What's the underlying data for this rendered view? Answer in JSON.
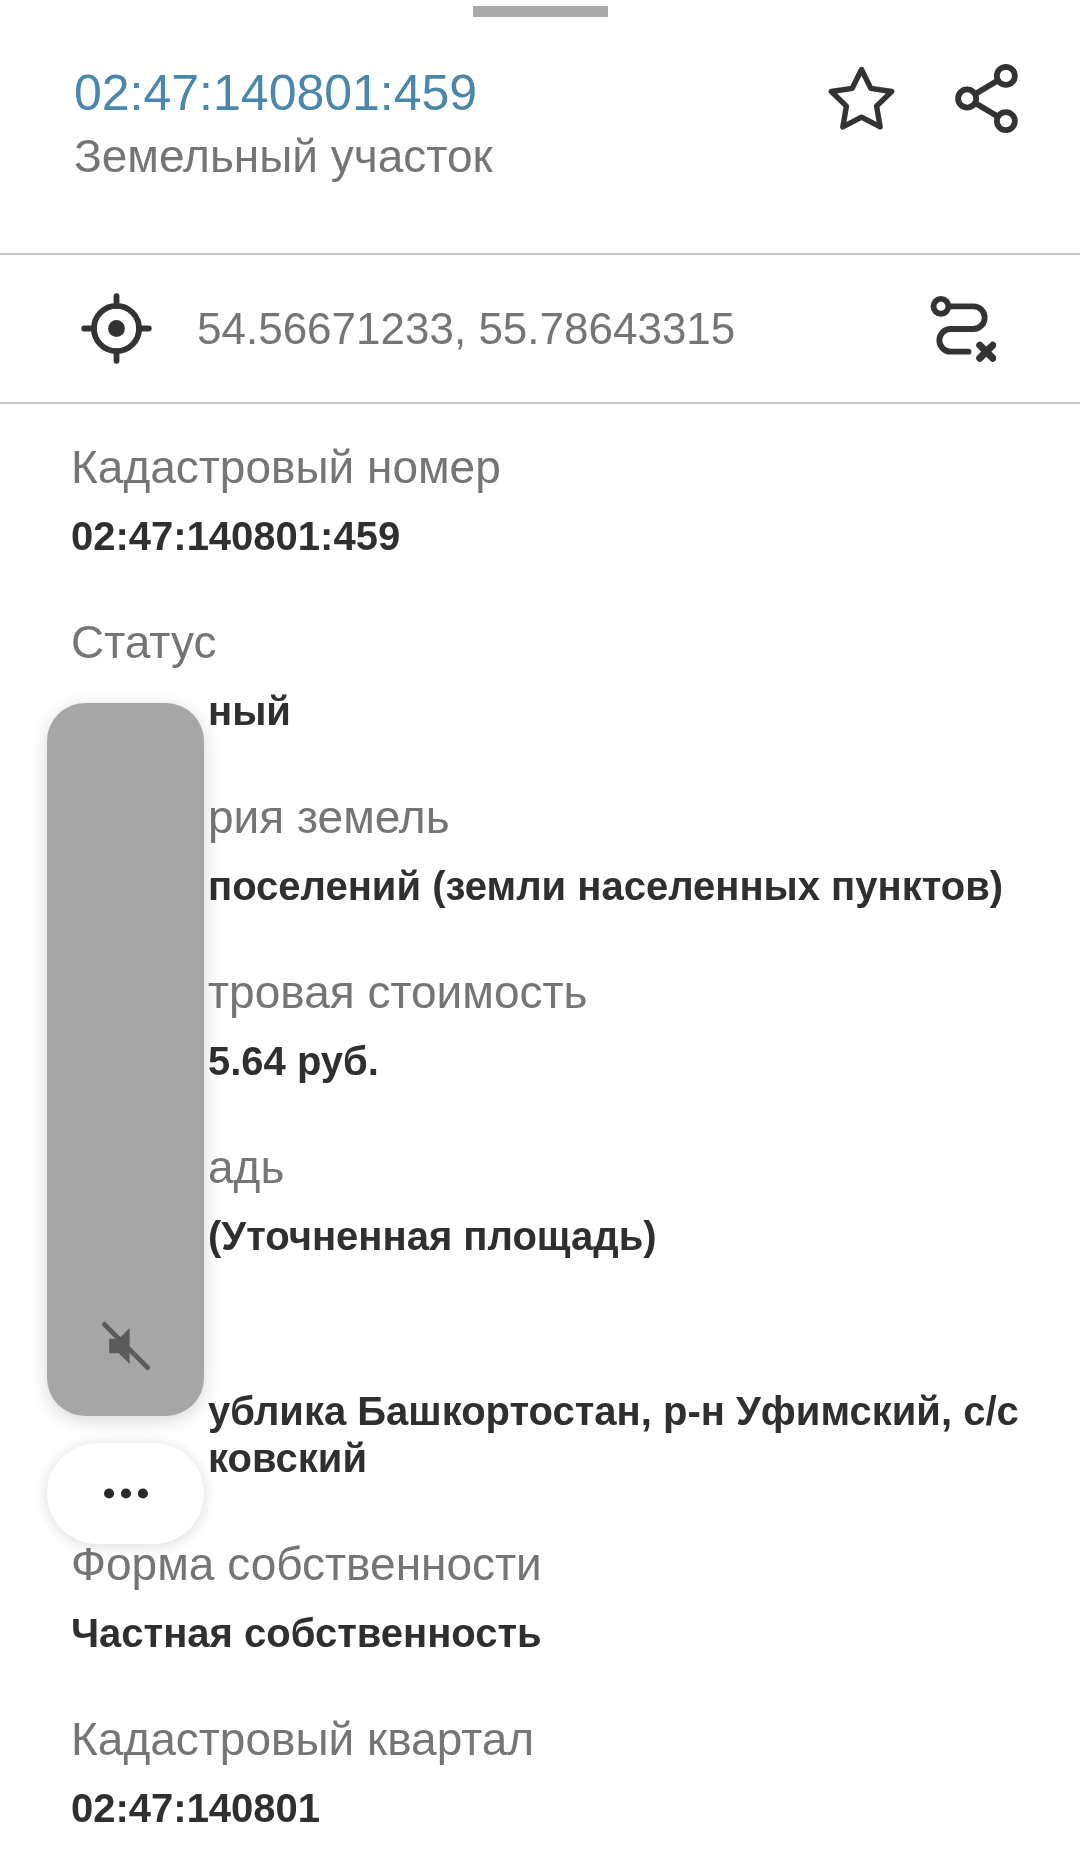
{
  "header": {
    "title": "02:47:140801:459",
    "subtitle": "Земельный участок",
    "favorite": false
  },
  "location": {
    "coordinates": "54.56671233, 55.78643315"
  },
  "fields": [
    {
      "label": "Кадастровый номер",
      "value": [
        "02:47:140801:459"
      ]
    },
    {
      "label": "Статус",
      "value": [
        "ный"
      ]
    },
    {
      "label": "рия земель",
      "value": [
        "поселений (земли населенных пунктов)"
      ]
    },
    {
      "label": "тровая стоимость",
      "value": [
        "5.64 руб."
      ]
    },
    {
      "label": "адь",
      "value": [
        "(Уточненная площадь)"
      ]
    },
    {
      "value": [
        "ублика Башкортостан, р-н Уфимский, с/с",
        "ковский"
      ]
    },
    {
      "label": "Форма собственности",
      "value": [
        "Частная собственность"
      ]
    },
    {
      "label": "Кадастровый квартал",
      "value": [
        "02:47:140801"
      ]
    }
  ],
  "volume_panel": {
    "muted": true
  }
}
